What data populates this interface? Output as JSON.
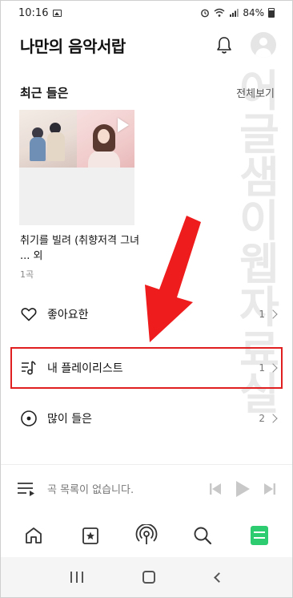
{
  "status_bar": {
    "time": "10:16",
    "battery": "84%"
  },
  "header": {
    "title": "나만의 음악서랍"
  },
  "recent": {
    "title": "최근 들은",
    "view_all": "전체보기",
    "album_title": "취기를 빌려 (취향저격 그녀 ... 외",
    "album_count": "1곡"
  },
  "library": [
    {
      "label": "좋아요한",
      "count": "1",
      "icon": "heart-icon"
    },
    {
      "label": "내 플레이리스트",
      "count": "1",
      "icon": "playlist-icon"
    },
    {
      "label": "많이 들은",
      "count": "2",
      "icon": "disc-icon"
    }
  ],
  "player": {
    "empty_text": "곡 목록이 없습니다."
  },
  "bottom_nav": [
    "home-icon",
    "star-card-icon",
    "radio-icon",
    "search-icon",
    "library-icon"
  ],
  "watermark": [
    "어",
    "글",
    "샘",
    "이",
    "웹",
    "자",
    "료",
    "실"
  ],
  "colors": {
    "accent_green": "#2ecc71",
    "highlight_red": "#e02020"
  }
}
